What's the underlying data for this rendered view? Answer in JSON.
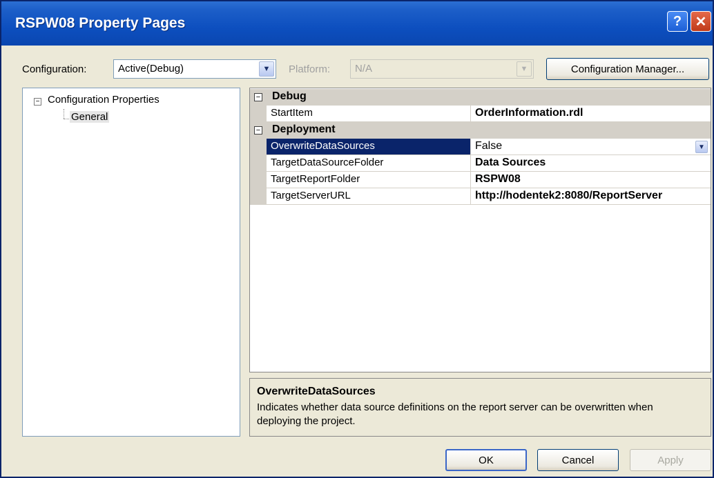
{
  "window": {
    "title": "RSPW08 Property Pages"
  },
  "titlebar": {
    "help_glyph": "?",
    "close_glyph": "✕"
  },
  "toolbar": {
    "configuration_label": "Configuration:",
    "configuration_value": "Active(Debug)",
    "platform_label": "Platform:",
    "platform_value": "N/A",
    "config_manager_label": "Configuration Manager..."
  },
  "tree": {
    "root_expander": "−",
    "root_label": "Configuration Properties",
    "child_label": "General"
  },
  "grid": {
    "categories": [
      {
        "name": "Debug",
        "expander": "−",
        "properties": [
          {
            "name": "StartItem",
            "value": "OrderInformation.rdl",
            "bold": true
          }
        ]
      },
      {
        "name": "Deployment",
        "expander": "−",
        "properties": [
          {
            "name": "OverwriteDataSources",
            "value": "False",
            "bold": false,
            "selected": true
          },
          {
            "name": "TargetDataSourceFolder",
            "value": "Data Sources",
            "bold": true
          },
          {
            "name": "TargetReportFolder",
            "value": "RSPW08",
            "bold": true
          },
          {
            "name": "TargetServerURL",
            "value": "http://hodentek2:8080/ReportServer",
            "bold": true
          }
        ]
      }
    ]
  },
  "description": {
    "title": "OverwriteDataSources",
    "text": "Indicates whether data source definitions on the report server can be overwritten when deploying the project."
  },
  "buttons": {
    "ok": "OK",
    "cancel": "Cancel",
    "apply": "Apply"
  },
  "colors": {
    "titlebar": "#0a46b0",
    "selection": "#0a246a",
    "window_bg": "#ece9d8"
  }
}
